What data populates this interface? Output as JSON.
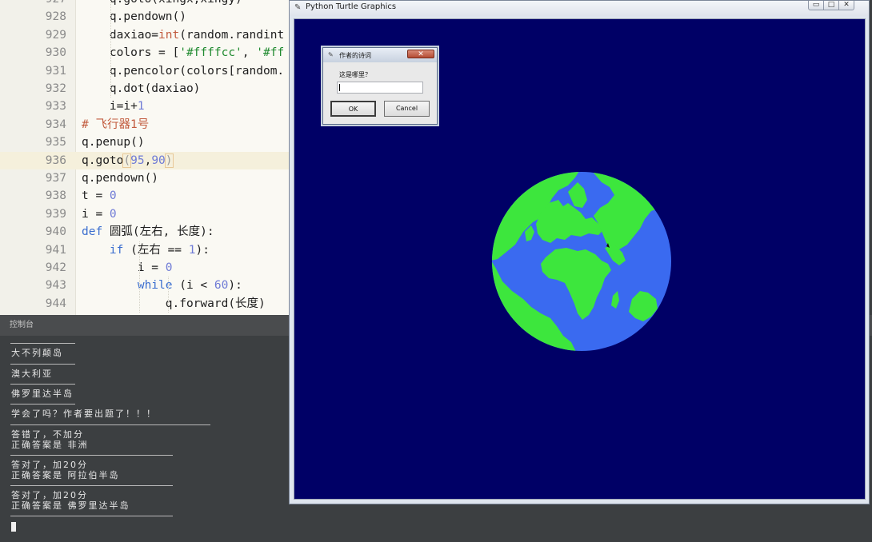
{
  "editor": {
    "lines": [
      {
        "no": "927",
        "parts": [
          [
            "",
            "    q.goto(xingx,xingy)"
          ]
        ]
      },
      {
        "no": "928",
        "parts": [
          [
            "",
            "    q.pendown()"
          ]
        ]
      },
      {
        "no": "929",
        "parts": [
          [
            "",
            "    daxiao="
          ],
          [
            "bi",
            "int"
          ],
          [
            "",
            "(random.randint"
          ]
        ]
      },
      {
        "no": "930",
        "parts": [
          [
            "",
            "    colors = ["
          ],
          [
            "str",
            "'#ffffcc'"
          ],
          [
            "",
            ", "
          ],
          [
            "str",
            "'#ff"
          ]
        ]
      },
      {
        "no": "931",
        "parts": [
          [
            "",
            "    q.pencolor(colors[random."
          ]
        ]
      },
      {
        "no": "932",
        "parts": [
          [
            "",
            "    q.dot(daxiao)"
          ]
        ]
      },
      {
        "no": "933",
        "parts": [
          [
            "",
            "    i=i+"
          ],
          [
            "num",
            "1"
          ]
        ]
      },
      {
        "no": "934",
        "parts": [
          [
            "cmt",
            "# 飞行器1号"
          ]
        ]
      },
      {
        "no": "935",
        "parts": [
          [
            "",
            "q.penup()"
          ]
        ]
      },
      {
        "no": "936",
        "parts": [
          [
            "",
            "q.goto"
          ],
          [
            "paren",
            "("
          ],
          [
            "num",
            "95"
          ],
          [
            "",
            ","
          ],
          [
            "num",
            "90"
          ],
          [
            "paren",
            ")"
          ]
        ]
      },
      {
        "no": "937",
        "parts": [
          [
            "",
            "q.pendown()"
          ]
        ]
      },
      {
        "no": "938",
        "parts": [
          [
            "",
            "t = "
          ],
          [
            "num",
            "0"
          ]
        ]
      },
      {
        "no": "939",
        "parts": [
          [
            "",
            "i = "
          ],
          [
            "num",
            "0"
          ]
        ]
      },
      {
        "no": "940",
        "parts": [
          [
            "kw",
            "def"
          ],
          [
            "",
            " 圆弧(左右, 长度):"
          ]
        ]
      },
      {
        "no": "941",
        "parts": [
          [
            "",
            "    "
          ],
          [
            "kw",
            "if"
          ],
          [
            "",
            " (左右 == "
          ],
          [
            "num",
            "1"
          ],
          [
            "",
            "):"
          ]
        ]
      },
      {
        "no": "942",
        "parts": [
          [
            "",
            "        i = "
          ],
          [
            "num",
            "0"
          ]
        ]
      },
      {
        "no": "943",
        "parts": [
          [
            "",
            "        "
          ],
          [
            "kw",
            "while"
          ],
          [
            "",
            " (i < "
          ],
          [
            "num",
            "60"
          ],
          [
            "",
            "):"
          ]
        ]
      },
      {
        "no": "944",
        "parts": [
          [
            "",
            "            q.forward(长度)"
          ]
        ]
      }
    ]
  },
  "console": {
    "title": "控制台",
    "outputs": [
      "大不列颠岛",
      "澳大利亚",
      "佛罗里达半岛",
      "学会了吗？作者要出题了！！！",
      "答错了，不加分\n正确答案是 非洲",
      "答对了，加20分\n正确答案是 阿拉伯半岛",
      "答对了，加20分\n正确答案是 佛罗里达半岛"
    ]
  },
  "turtle_window": {
    "title": "Python Turtle Graphics",
    "controls": {
      "minimize": "▭",
      "maximize": "□",
      "close": "✕"
    },
    "canvas_color": "#000066",
    "globe": {
      "ocean_color": "#3a6af0",
      "land_color": "#3de63d"
    }
  },
  "dialog": {
    "title": "作者的诗词",
    "prompt": "这是哪里？",
    "input_value": "",
    "ok_label": "OK",
    "cancel_label": "Cancel",
    "close_label": "✕"
  }
}
